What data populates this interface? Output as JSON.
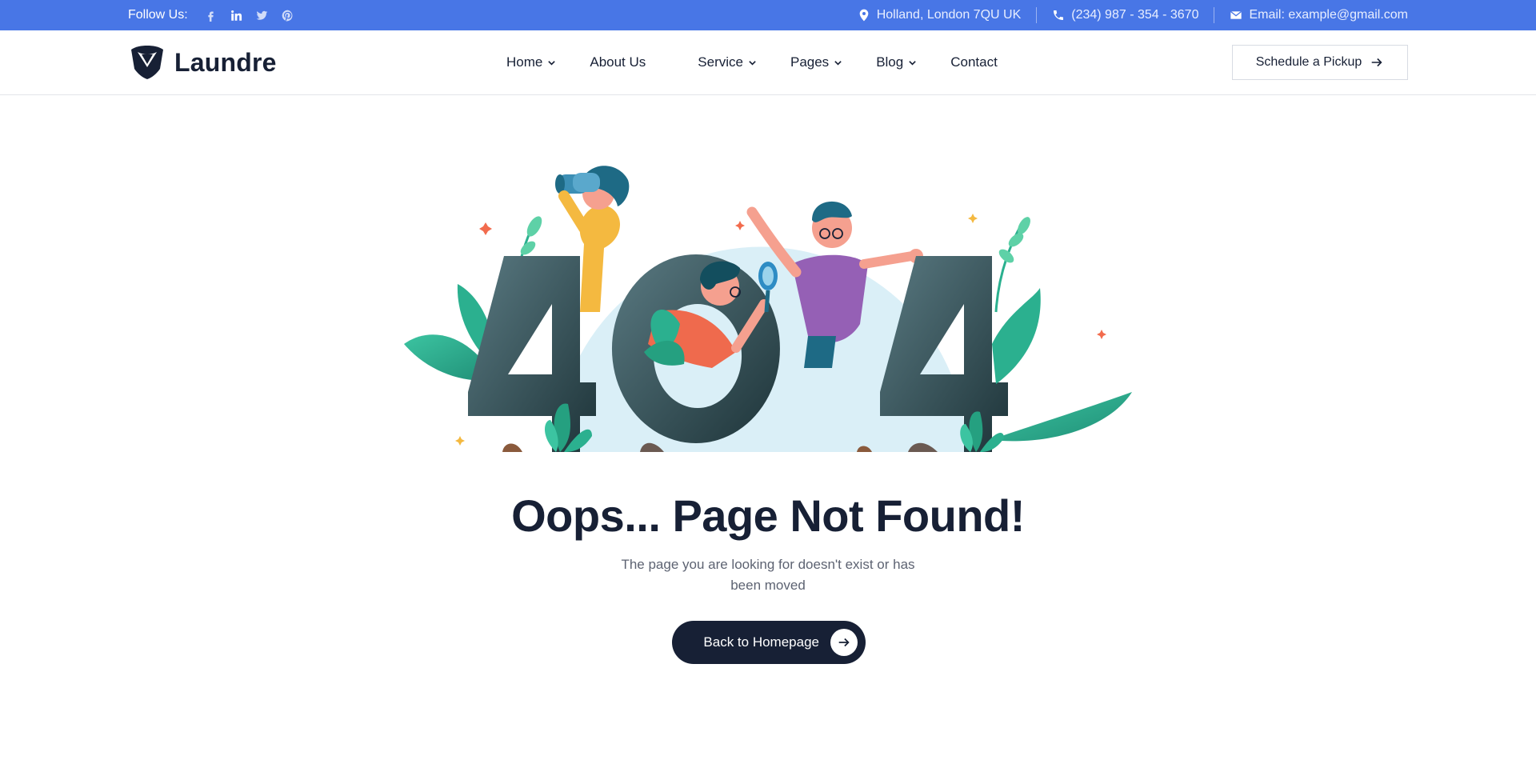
{
  "topbar": {
    "follow_label": "Follow Us:",
    "social_icons": [
      "facebook-icon",
      "linkedin-icon",
      "twitter-icon",
      "pinterest-icon"
    ],
    "address": "Holland, London 7QU UK",
    "phone": "(234) 987 - 354 - 3670",
    "email": "Email: example@gmail.com"
  },
  "header": {
    "logo_text": "Laundre",
    "nav": [
      {
        "label": "Home",
        "has_dropdown": true
      },
      {
        "label": "About Us",
        "has_dropdown": false
      },
      {
        "label": "Service",
        "has_dropdown": true
      },
      {
        "label": "Pages",
        "has_dropdown": true
      },
      {
        "label": "Blog",
        "has_dropdown": true
      },
      {
        "label": "Contact",
        "has_dropdown": false
      }
    ],
    "cta_label": "Schedule a Pickup"
  },
  "main": {
    "title": "Oops... Page Not Found!",
    "subtitle": "The page you are looking for doesn't exist or has been moved",
    "button_label": "Back to Homepage"
  },
  "colors": {
    "topbar": "#4876e6",
    "navy": "#172035",
    "text_muted": "#5d6372",
    "digit_dark": "#263f45",
    "digit_light": "#5a7a82",
    "leaf": "#2bb08f",
    "sky": "#daeff7"
  }
}
